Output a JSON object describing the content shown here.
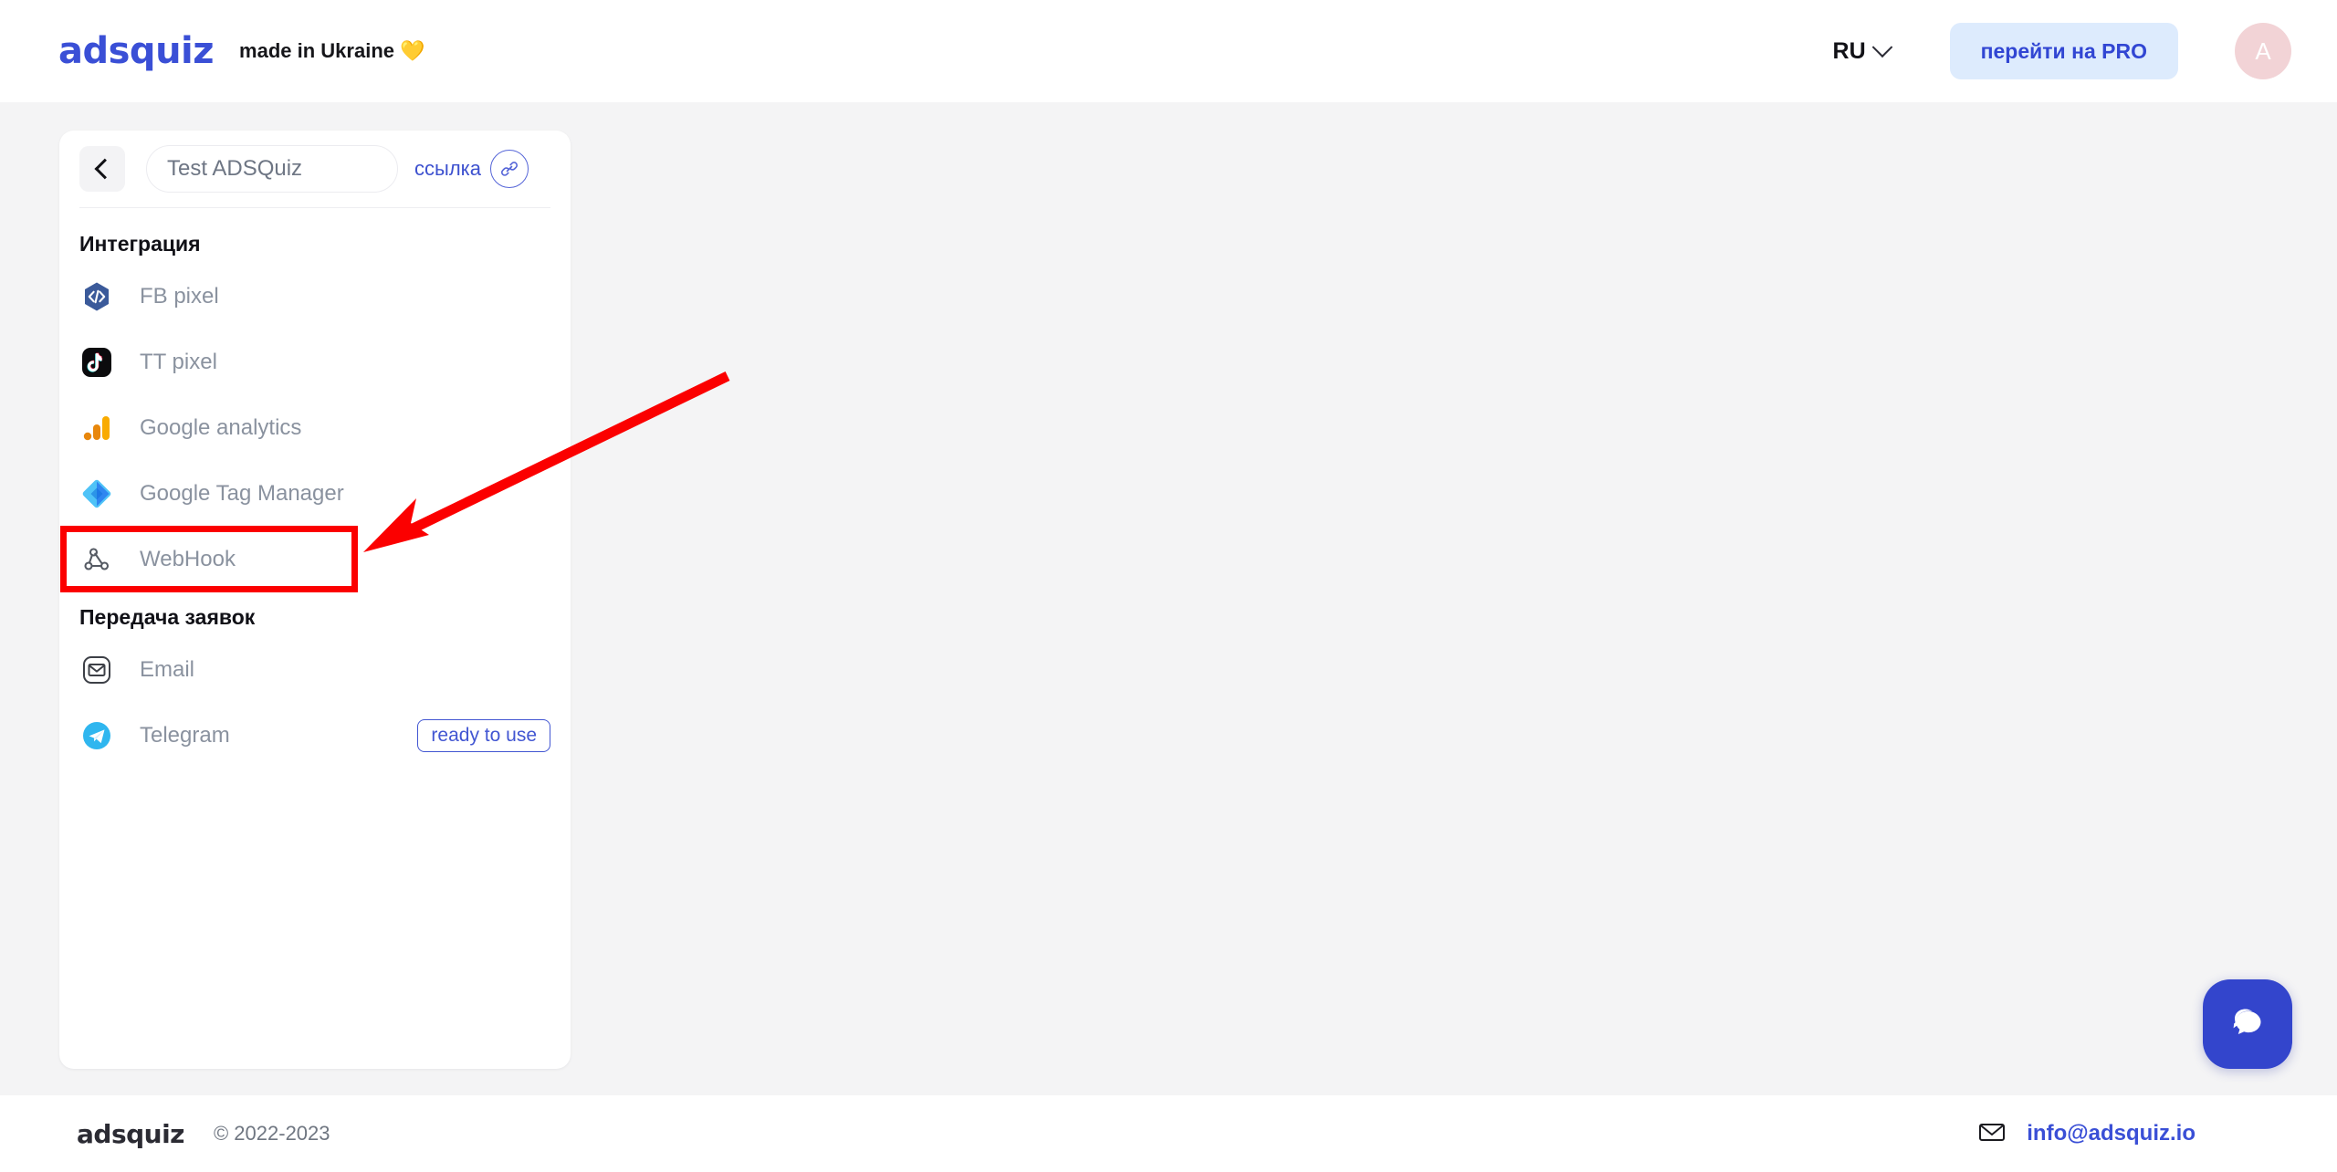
{
  "header": {
    "logo": "adsquiz",
    "tagline": "made in Ukraine",
    "heart": "💛",
    "language": "RU",
    "pro_button": "перейти на PRO",
    "avatar_initial": "A"
  },
  "panel": {
    "back_icon": "chevron-left-icon",
    "quiz_name_value": "Test ADSQuiz",
    "quiz_name_placeholder": "Test ADSQuiz",
    "link_label": "ссылка",
    "link_icon": "link-icon",
    "sections": [
      {
        "title": "Интеграция",
        "items": [
          {
            "label": "FB pixel",
            "icon": "fb-pixel-icon",
            "badge": ""
          },
          {
            "label": "TT pixel",
            "icon": "tiktok-pixel-icon",
            "badge": ""
          },
          {
            "label": "Google analytics",
            "icon": "google-analytics-icon",
            "badge": ""
          },
          {
            "label": "Google Tag Manager",
            "icon": "google-tag-manager-icon",
            "badge": ""
          },
          {
            "label": "WebHook",
            "icon": "webhook-icon",
            "badge": ""
          }
        ]
      },
      {
        "title": "Передача заявок",
        "items": [
          {
            "label": "Email",
            "icon": "email-icon",
            "badge": ""
          },
          {
            "label": "Telegram",
            "icon": "telegram-icon",
            "badge": "ready to use"
          }
        ]
      }
    ]
  },
  "annotation": {
    "highlight_target": "WebHook",
    "highlight_color": "#fb0000",
    "arrow_color": "#fb0000"
  },
  "footer": {
    "logo": "adsquiz",
    "copyright": "© 2022-2023",
    "email": "info@adsquiz.io",
    "email_icon": "envelope-icon"
  },
  "chat": {
    "icon": "chat-bubbles-icon"
  },
  "colors": {
    "brand": "#3a4fd6",
    "accent_bg": "#ddebfd",
    "page_bg": "#f4f4f5",
    "muted_text": "#8a929f"
  }
}
